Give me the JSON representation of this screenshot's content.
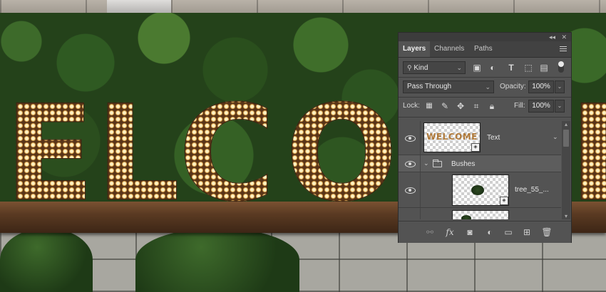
{
  "scene": {
    "letters": [
      "E",
      "L",
      "C",
      "O",
      "E"
    ]
  },
  "panel": {
    "header": {
      "collapse_icon": "double-chevron-icon",
      "close_icon": "close-icon"
    },
    "tabs": [
      {
        "label": "Layers",
        "active": true
      },
      {
        "label": "Channels",
        "active": false
      },
      {
        "label": "Paths",
        "active": false
      }
    ],
    "filter": {
      "kind_label": "Kind",
      "icons": [
        "image-filter-icon",
        "adjustment-filter-icon",
        "type-filter-icon",
        "shape-filter-icon",
        "smart-object-filter-icon"
      ]
    },
    "blend": {
      "mode": "Pass Through",
      "opacity_label": "Opacity:",
      "opacity_value": "100%"
    },
    "lock": {
      "label": "Lock:",
      "fill_label": "Fill:",
      "fill_value": "100%"
    },
    "layers": [
      {
        "name": "Text",
        "thumb_text": "WELCOME",
        "type": "smart-object",
        "visible": true
      },
      {
        "name": "Bushes",
        "type": "group",
        "expanded": true,
        "visible": true
      },
      {
        "name": "tree_55_...",
        "type": "smart-object",
        "visible": true
      },
      {
        "name": "",
        "type": "smart-object",
        "visible": false
      }
    ],
    "footer_icons": [
      "link-layers-icon",
      "fx-icon",
      "layer-mask-icon",
      "adjustment-layer-icon",
      "new-group-icon",
      "new-layer-icon",
      "delete-icon"
    ]
  }
}
